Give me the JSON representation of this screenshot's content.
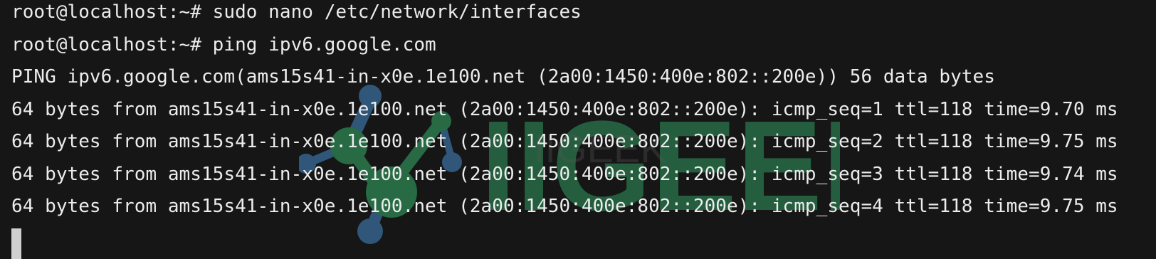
{
  "terminal": {
    "lines": [
      "root@localhost:~# sudo nano /etc/network/interfaces",
      "root@localhost:~# ping ipv6.google.com",
      "PING ipv6.google.com(ams15s41-in-x0e.1e100.net (2a00:1450:400e:802::200e)) 56 data bytes",
      "64 bytes from ams15s41-in-x0e.1e100.net (2a00:1450:400e:802::200e): icmp_seq=1 ttl=118 time=9.70 ms",
      "64 bytes from ams15s41-in-x0e.1e100.net (2a00:1450:400e:802::200e): icmp_seq=2 ttl=118 time=9.75 ms",
      "64 bytes from ams15s41-in-x0e.1e100.net (2a00:1450:400e:802::200e): icmp_seq=3 ttl=118 time=9.74 ms",
      "64 bytes from ams15s41-in-x0e.1e100.net (2a00:1450:400e:802::200e): icmp_seq=4 ttl=118 time=9.75 ms"
    ]
  },
  "watermark": {
    "text": "IIGEEK",
    "colors": {
      "green": "#2e8b57",
      "blue": "#3a6fa0"
    }
  },
  "colors": {
    "background": "#161616",
    "text": "#ececec",
    "cursor": "#cfcfcf"
  }
}
